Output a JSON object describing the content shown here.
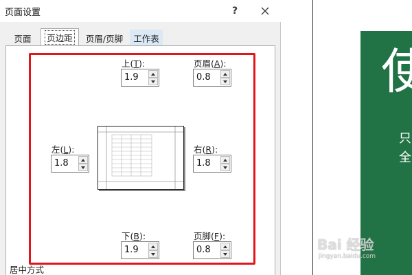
{
  "dialog": {
    "title": "页面设置",
    "help": "?",
    "tabs": [
      {
        "label": "页面"
      },
      {
        "label": "页边距"
      },
      {
        "label": "页眉/页脚"
      },
      {
        "label": "工作表"
      }
    ],
    "active_tab": "页边距"
  },
  "margins": {
    "top": {
      "label": "上",
      "key": "T",
      "value": "1.9"
    },
    "header": {
      "label": "页眉",
      "key": "A",
      "value": "0.8"
    },
    "left": {
      "label": "左",
      "key": "L",
      "value": "1.8"
    },
    "right": {
      "label": "右",
      "key": "R",
      "value": "1.8"
    },
    "bottom": {
      "label": "下",
      "key": "B",
      "value": "1.9"
    },
    "footer": {
      "label": "页脚",
      "key": "F",
      "value": "0.8"
    }
  },
  "section": {
    "center_label": "居中方式"
  },
  "background": {
    "big_char": "使",
    "line1": "只",
    "line2": "全",
    "watermark_main": "Bai 经验",
    "watermark_sub": "jingyan.baidu.com"
  },
  "colors": {
    "accent_red": "#e3141b",
    "green": "#217346",
    "tab_highlight": "#dbe8f5"
  }
}
